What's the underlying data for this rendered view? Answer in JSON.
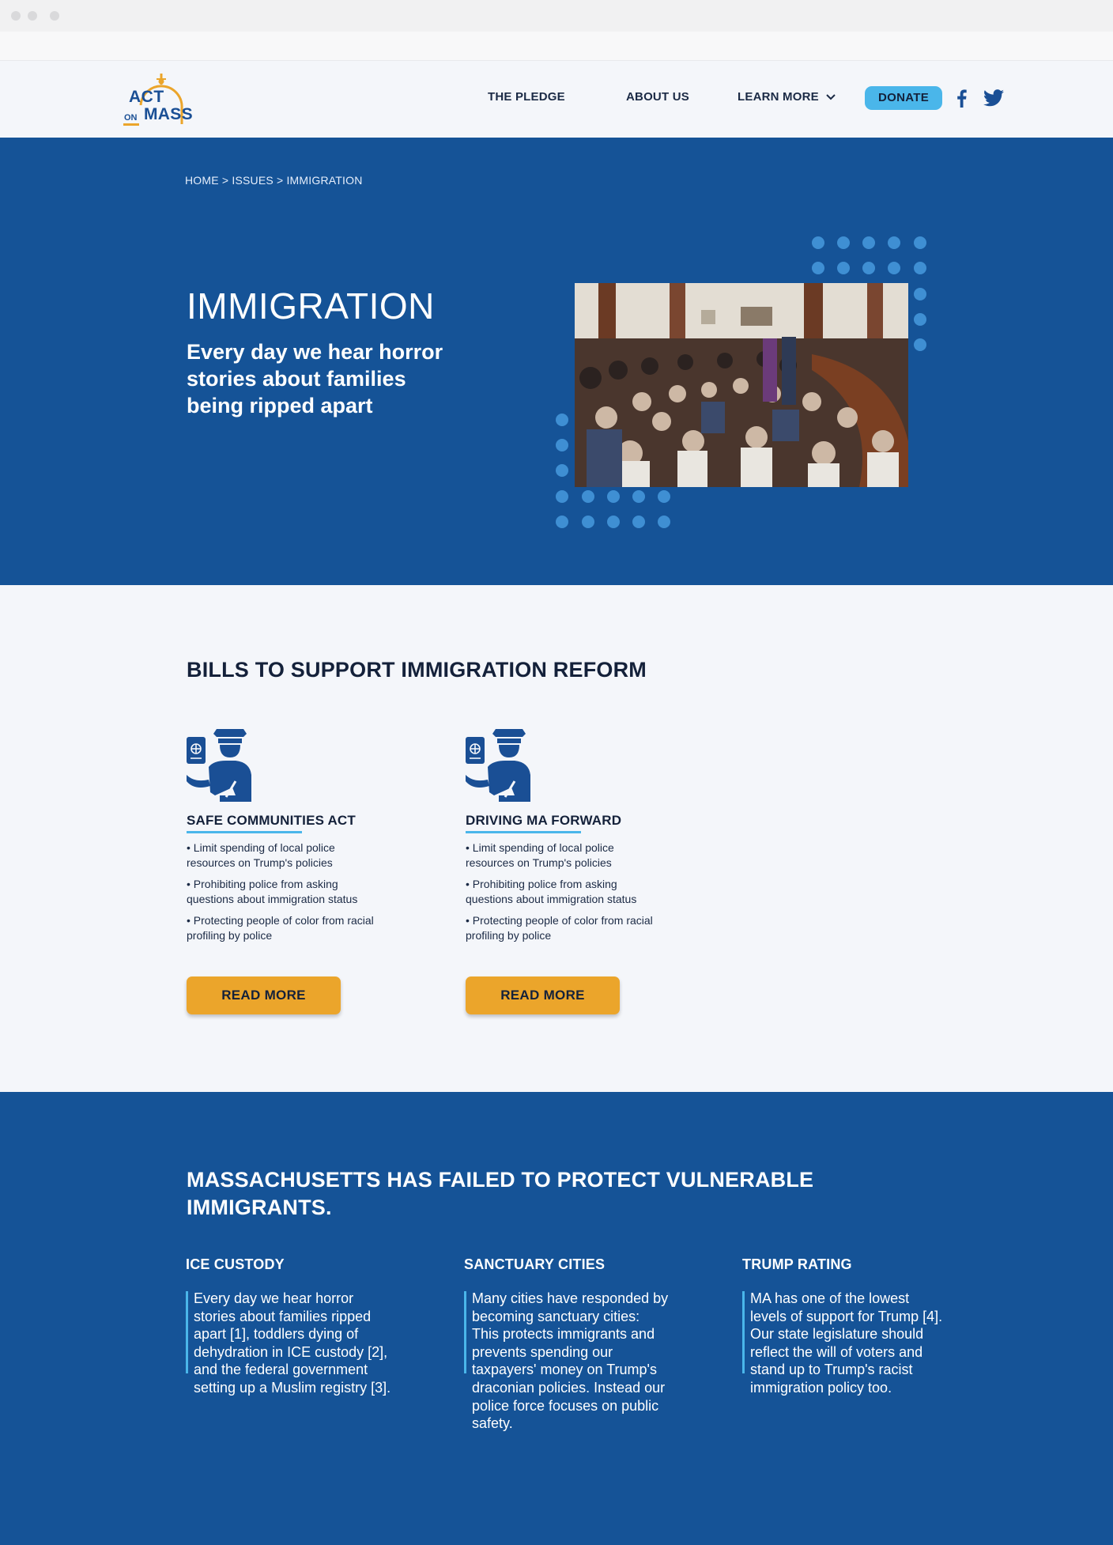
{
  "nav": {
    "logo_top": "ACT",
    "logo_on": "ON",
    "logo_bottom": "MASS",
    "items": [
      "THE PLEDGE",
      "ABOUT US",
      "LEARN MORE"
    ],
    "donate": "DONATE"
  },
  "hero": {
    "breadcrumb": "HOME > ISSUES > IMMIGRATION",
    "title": "IMMIGRATION",
    "subtitle": "Every day we hear horror stories about families being ripped apart"
  },
  "bills": {
    "title": "BILLS TO SUPPORT IMMIGRATION REFORM",
    "items": [
      {
        "name": "SAFE COMMUNITIES ACT",
        "points": [
          "• Limit spending of local police resources on Trump's policies",
          "• Prohibiting police from asking questions about immigration status",
          "• Protecting people of color from racial profiling by police"
        ],
        "button": "READ MORE"
      },
      {
        "name": "DRIVING MA FORWARD",
        "points": [
          "• Limit spending of local police resources on Trump's policies",
          "• Prohibiting police from asking questions about immigration status",
          "• Protecting people of color from racial profiling by police"
        ],
        "button": "READ MORE"
      }
    ]
  },
  "failed": {
    "title": "MASSACHUSETTS HAS FAILED TO PROTECT VULNERABLE IMMIGRANTS.",
    "columns": [
      {
        "heading": "ICE CUSTODY",
        "body": "Every day we hear horror stories about families ripped apart [1], toddlers dying of dehydration in ICE custody [2], and the federal government setting up a Muslim registry [3]."
      },
      {
        "heading": "SANCTUARY CITIES",
        "body": "Many cities have responded by becoming sanctuary cities: This protects immigrants and prevents spending our taxpayers' money on Trump's draconian policies. Instead our police force focuses on public safety."
      },
      {
        "heading": "TRUMP RATING",
        "body": "MA has one of the lowest levels of support for Trump [4]. Our state legislature should reflect the will of voters and stand up to Trump's racist immigration policy too."
      }
    ]
  },
  "colors": {
    "brand_blue": "#155397",
    "accent_blue": "#4ab6ea",
    "accent_orange": "#eba52b",
    "dot_blue": "#3f8fd3"
  },
  "icons": {
    "officer": "immigration-officer-icon",
    "facebook": "facebook-icon",
    "twitter": "twitter-icon",
    "chevron": "chevron-down-icon"
  }
}
